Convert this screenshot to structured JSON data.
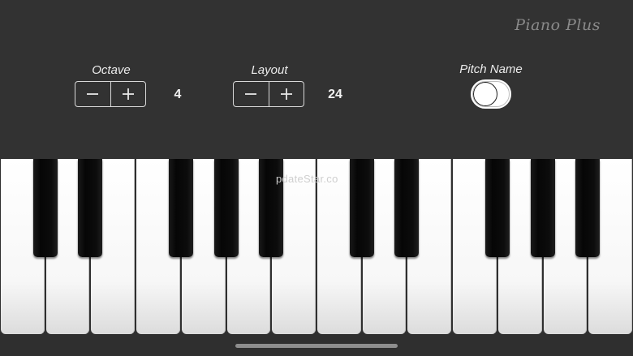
{
  "brand": "Piano Plus",
  "octave": {
    "label": "Octave",
    "value": "4",
    "minus_icon": "minus-icon",
    "plus_icon": "plus-icon"
  },
  "layout": {
    "label": "Layout",
    "value": "24",
    "minus_icon": "minus-icon",
    "plus_icon": "plus-icon"
  },
  "pitch_name": {
    "label": "Pitch Name",
    "enabled": false
  },
  "keyboard": {
    "white_key_count": 14,
    "black_key_count": 10
  },
  "watermark": "pdateStar.co",
  "colors": {
    "background": "#323232",
    "white_key": "#ffffff",
    "black_key": "#0a0a0a",
    "text": "#ececec"
  }
}
